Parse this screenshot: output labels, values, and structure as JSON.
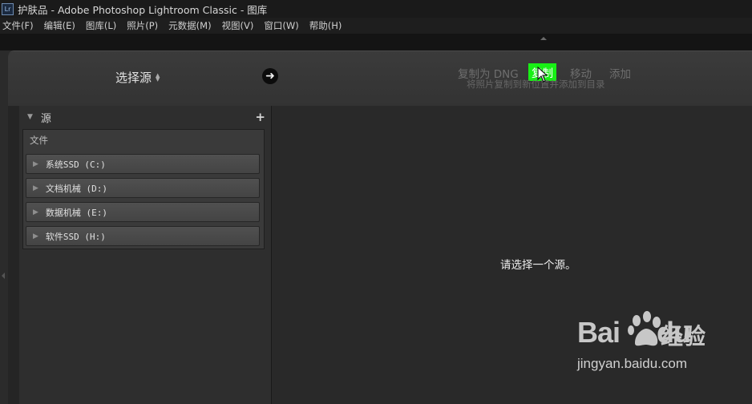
{
  "window": {
    "icon_label": "Lr",
    "title": "护肤品 - Adobe Photoshop Lightroom Classic - 图库"
  },
  "menu": [
    "文件(F)",
    "编辑(E)",
    "图库(L)",
    "照片(P)",
    "元数据(M)",
    "视图(V)",
    "窗口(W)",
    "帮助(H)"
  ],
  "import_header": {
    "source_label": "选择源",
    "modes": {
      "dng": "复制为 DNG",
      "copy": "复制",
      "move": "移动",
      "add": "添加"
    },
    "selected_mode": "复制",
    "mode_description": "将照片复制到新位置并添加到目录",
    "colors": {
      "selected_mode_bg": "#18f015"
    }
  },
  "source_panel": {
    "title": "源",
    "add_icon": "plus-icon",
    "files_label": "文件",
    "drives": [
      "系统SSD (C:)",
      "文档机械 (D:)",
      "数据机械 (E:)",
      "软件SSD (H:)"
    ]
  },
  "main": {
    "empty_message": "请选择一个源。"
  },
  "watermark": {
    "logo": "Bai",
    "logo_end": "du",
    "cn": "经验",
    "url": "jingyan.baidu.com"
  }
}
